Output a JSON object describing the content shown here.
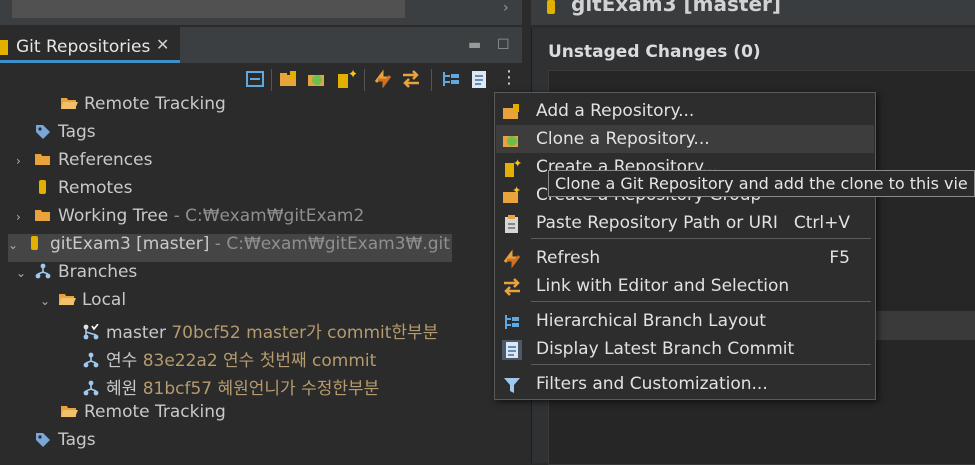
{
  "top": {
    "right_title": "gitExam3 [master]"
  },
  "view": {
    "tab_label": "Git Repositories",
    "close_glyph": "✕"
  },
  "tree": [
    {
      "id": "remote-tracking-1",
      "label": "Remote Tracking",
      "icon": "folder-open-icon",
      "twisty": ""
    },
    {
      "id": "tags-1",
      "label": "Tags",
      "icon": "tag-icon",
      "twisty": ""
    },
    {
      "id": "references",
      "label": "References",
      "icon": "folder-icon",
      "twisty": "›"
    },
    {
      "id": "remotes",
      "label": "Remotes",
      "icon": "remote-icon",
      "twisty": ""
    },
    {
      "id": "working-tree",
      "label": "Working Tree",
      "meta": " - C:₩exam₩gitExam2",
      "icon": "folder-icon",
      "twisty": "›"
    },
    {
      "id": "gitexam3",
      "label": "gitExam3 [master]",
      "meta": " - C:₩exam₩gitExam3₩.git",
      "icon": "repository-icon",
      "twisty": "⌄"
    },
    {
      "id": "branches",
      "label": "Branches",
      "icon": "branch-icon",
      "twisty": "⌄"
    },
    {
      "id": "local",
      "label": "Local",
      "icon": "folder-open-icon",
      "twisty": "⌄"
    },
    {
      "id": "branch-master",
      "label": "master",
      "commit": "70bcf52 master가 commit한부분",
      "icon": "branch-checked-out-icon"
    },
    {
      "id": "branch-yeonsu",
      "label": "연수",
      "commit": "83e22a2 연수 첫번째 commit",
      "icon": "branch-icon"
    },
    {
      "id": "branch-hyewon",
      "label": "혜원",
      "commit": "81bcf57 혜원언니가 수정한부분",
      "icon": "branch-icon"
    },
    {
      "id": "remote-tracking-2",
      "label": "Remote Tracking",
      "icon": "folder-open-icon",
      "twisty": ""
    },
    {
      "id": "tags-2",
      "label": "Tags",
      "icon": "tag-icon",
      "twisty": ""
    }
  ],
  "right_panel": {
    "unstaged_title": "Unstaged Changes (0)"
  },
  "menu": {
    "items": [
      {
        "label": "Add a Repository...",
        "shortcut": ""
      },
      {
        "label": "Clone a Repository...",
        "shortcut": ""
      },
      {
        "label": "Create a Repository...",
        "shortcut": ""
      },
      {
        "label": "Create a Repository Group",
        "shortcut": ""
      },
      {
        "label": "Paste Repository Path or URI",
        "shortcut": "Ctrl+V"
      },
      {
        "label": "Refresh",
        "shortcut": "F5"
      },
      {
        "label": "Link with Editor and Selection",
        "shortcut": ""
      },
      {
        "label": "Hierarchical Branch Layout",
        "shortcut": ""
      },
      {
        "label": "Display Latest Branch Commit",
        "shortcut": ""
      },
      {
        "label": "Filters and Customization...",
        "shortcut": ""
      }
    ]
  },
  "tooltip": {
    "text": "Clone a Git Repository and add the clone to this vie"
  },
  "colors": {
    "accent": "#3c8fc7",
    "commit_text": "#b59b6d",
    "folder": "#e8a33d"
  }
}
